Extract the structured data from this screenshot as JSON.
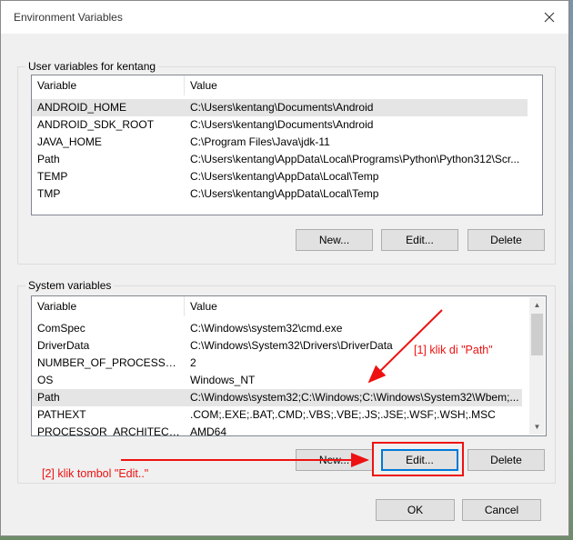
{
  "window": {
    "title": "Environment Variables"
  },
  "user_vars": {
    "label": "User variables for kentang",
    "columns": [
      "Variable",
      "Value"
    ],
    "rows": [
      [
        "ANDROID_HOME",
        "C:\\Users\\kentang\\Documents\\Android"
      ],
      [
        "ANDROID_SDK_ROOT",
        "C:\\Users\\kentang\\Documents\\Android"
      ],
      [
        "JAVA_HOME",
        "C:\\Program Files\\Java\\jdk-11"
      ],
      [
        "Path",
        "C:\\Users\\kentang\\AppData\\Local\\Programs\\Python\\Python312\\Scr..."
      ],
      [
        "TEMP",
        "C:\\Users\\kentang\\AppData\\Local\\Temp"
      ],
      [
        "TMP",
        "C:\\Users\\kentang\\AppData\\Local\\Temp"
      ]
    ],
    "selected_index": 0,
    "buttons": {
      "new": "New...",
      "edit": "Edit...",
      "delete": "Delete"
    }
  },
  "system_vars": {
    "label": "System variables",
    "columns": [
      "Variable",
      "Value"
    ],
    "rows": [
      [
        "ComSpec",
        "C:\\Windows\\system32\\cmd.exe"
      ],
      [
        "DriverData",
        "C:\\Windows\\System32\\Drivers\\DriverData"
      ],
      [
        "NUMBER_OF_PROCESSORS",
        "2"
      ],
      [
        "OS",
        "Windows_NT"
      ],
      [
        "Path",
        "C:\\Windows\\system32;C:\\Windows;C:\\Windows\\System32\\Wbem;..."
      ],
      [
        "PATHEXT",
        ".COM;.EXE;.BAT;.CMD;.VBS;.VBE;.JS;.JSE;.WSF;.WSH;.MSC"
      ],
      [
        "PROCESSOR_ARCHITECTURE",
        "AMD64"
      ]
    ],
    "selected_index": 4,
    "buttons": {
      "new": "New...",
      "edit": "Edit...",
      "delete": "Delete"
    }
  },
  "footer": {
    "ok": "OK",
    "cancel": "Cancel"
  },
  "annotations": {
    "step1": "[1] klik di \"Path\"",
    "step2": "[2] klik tombol \"Edit..\"",
    "color": "#ee1111"
  }
}
